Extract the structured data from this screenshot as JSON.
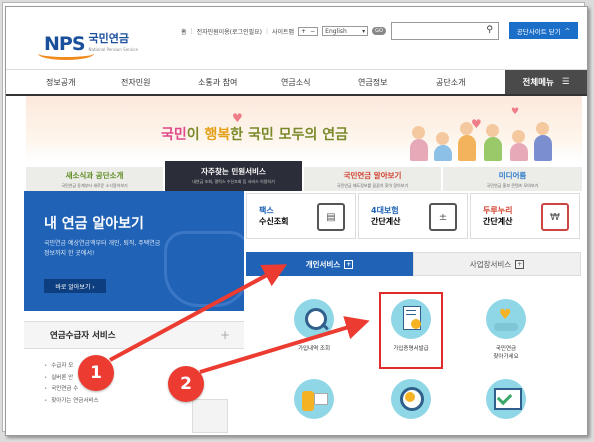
{
  "header": {
    "logo_text": "NPS",
    "logo_kr": "국민연금",
    "logo_sub": "National Pension Service",
    "util_home": "홈",
    "util_certificate": "전자민원이용(로그인필요)",
    "util_sitemap": "사이트맵",
    "util_plus": "+",
    "util_minus": "−",
    "language": "English",
    "language_go": "GO",
    "close_sites_label": "공단사이트 닫기"
  },
  "nav": {
    "items": [
      "정보공개",
      "전자민원",
      "소통과 참여",
      "연금소식",
      "연금정보",
      "공단소개"
    ],
    "all_menu_label": "전체메뉴"
  },
  "banner": {
    "slogan_a": "국민",
    "slogan_b": "이 ",
    "slogan_c": "행복",
    "slogan_d": "한 국민 모두의 연금"
  },
  "tabs": [
    {
      "title": "새소식과 공단소개",
      "sub": "국민연금 동계부터 새로운 소식알아보기"
    },
    {
      "title": "자주찾는 민원서비스",
      "sub": "내연금 조회, 갤럭스 수신조회 등 서비스 이용하기"
    },
    {
      "title": "국민연금 알아보기",
      "sub": "국민연금 제도정보를 꼼꼼히 찾아 알아보기"
    },
    {
      "title": "미디어룸",
      "sub": "국민연금 홍보 콘텐츠 모아보기"
    }
  ],
  "my_pension": {
    "title": "내 연금 알아보기",
    "desc": "국민연금 예상연금액부터 개인, 퇴직, 주택연금 정보까지 한 곳에서!",
    "button": "바로 알아보기 ›"
  },
  "recipient": {
    "title": "연금수급자 서비스",
    "plus": "+",
    "items": [
      "수급자 모",
      "실버론 안",
      "국민연금 수",
      "찾아가는 연금서비스"
    ]
  },
  "quick": [
    {
      "label_1": "팩스",
      "label_2": "수신조회",
      "icon": "fax-icon"
    },
    {
      "label_1": "4대보험",
      "label_2": "간단계산",
      "icon": "calculator-icon"
    },
    {
      "label_1": "두루누리",
      "label_2": "간단계산",
      "icon": "calculator-doc-icon"
    }
  ],
  "service_tabs": {
    "personal": "개인서비스",
    "business": "사업장서비스"
  },
  "services": [
    {
      "label": "가입내역 조회",
      "icon": "search-people-icon"
    },
    {
      "label": "가입증명서발급",
      "icon": "certificate-icon"
    },
    {
      "label": "국민연금\n찾아가세요",
      "icon": "heart-hands-icon"
    },
    {
      "label": "",
      "icon": "coins-icon"
    },
    {
      "label": "",
      "icon": "magnifier-icon"
    },
    {
      "label": "",
      "icon": "checkmark-monitor-icon"
    }
  ],
  "annotations": {
    "badge_1": "1",
    "badge_2": "2"
  },
  "colors": {
    "brand_blue": "#1f62b6",
    "accent_orange": "#f08a1c",
    "annotation_red": "#ec3b30"
  }
}
